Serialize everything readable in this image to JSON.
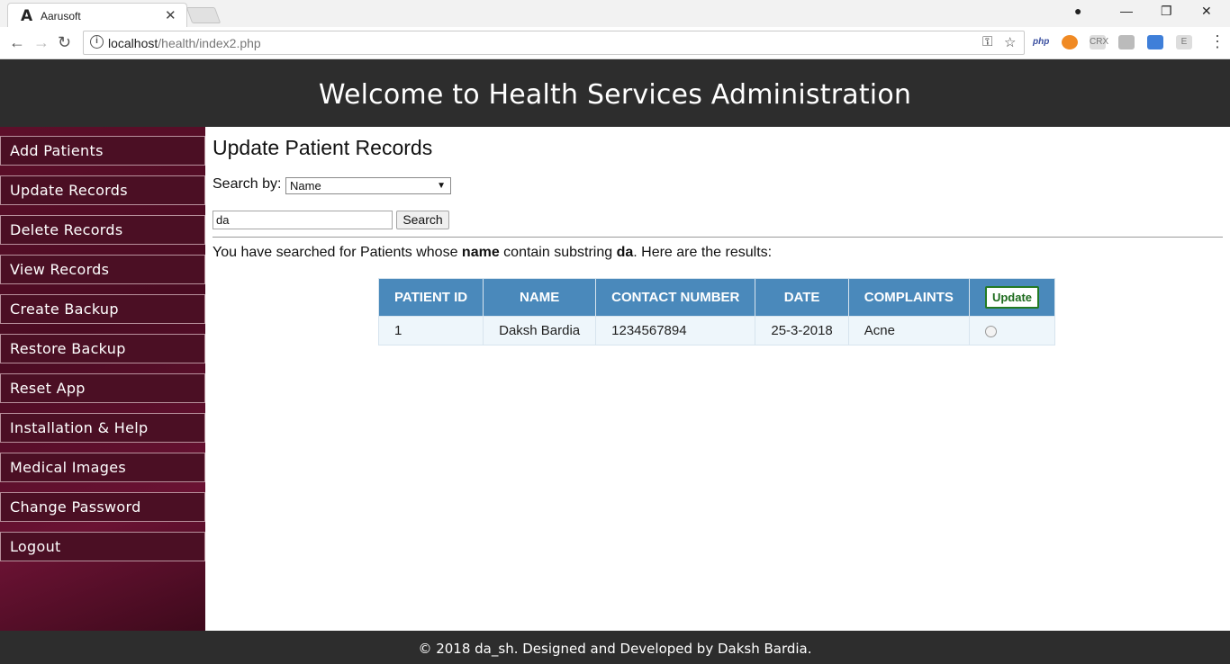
{
  "browser": {
    "tab_title": "Aarusoft",
    "tab_logo": "A",
    "url_host": "localhost",
    "url_path": "/health/index2.php",
    "extensions": [
      "php",
      "",
      "CRX",
      "",
      "",
      "E"
    ]
  },
  "header": {
    "title": "Welcome to Health Services Administration"
  },
  "sidebar": {
    "items": [
      {
        "label": "Add Patients"
      },
      {
        "label": "Update Records"
      },
      {
        "label": "Delete Records"
      },
      {
        "label": "View Records"
      },
      {
        "label": "Create Backup"
      },
      {
        "label": "Restore Backup"
      },
      {
        "label": "Reset App"
      },
      {
        "label": "Installation & Help"
      },
      {
        "label": "Medical Images"
      },
      {
        "label": "Change Password"
      },
      {
        "label": "Logout"
      }
    ]
  },
  "main": {
    "title": "Update Patient Records",
    "search_by_label": "Search by:",
    "search_by_value": "Name",
    "search_value": "da",
    "search_button": "Search",
    "result_prefix": "You have searched for Patients whose ",
    "result_field": "name",
    "result_middle": " contain substring ",
    "result_term": "da",
    "result_suffix": ". Here are the results:"
  },
  "table": {
    "headers": [
      "PATIENT ID",
      "NAME",
      "CONTACT NUMBER",
      "DATE",
      "COMPLAINTS"
    ],
    "update_button": "Update",
    "rows": [
      {
        "id": "1",
        "name": "Daksh Bardia",
        "contact": "1234567894",
        "date": "25-3-2018",
        "complaints": "Acne"
      }
    ]
  },
  "footer": {
    "text": "© 2018 da_sh. Designed and Developed by Daksh Bardia."
  },
  "colors": {
    "header_bg": "#2d2d2d",
    "sidebar_bg": "#4b0f24",
    "table_header": "#4a89bb",
    "update_border": "#237a23"
  }
}
